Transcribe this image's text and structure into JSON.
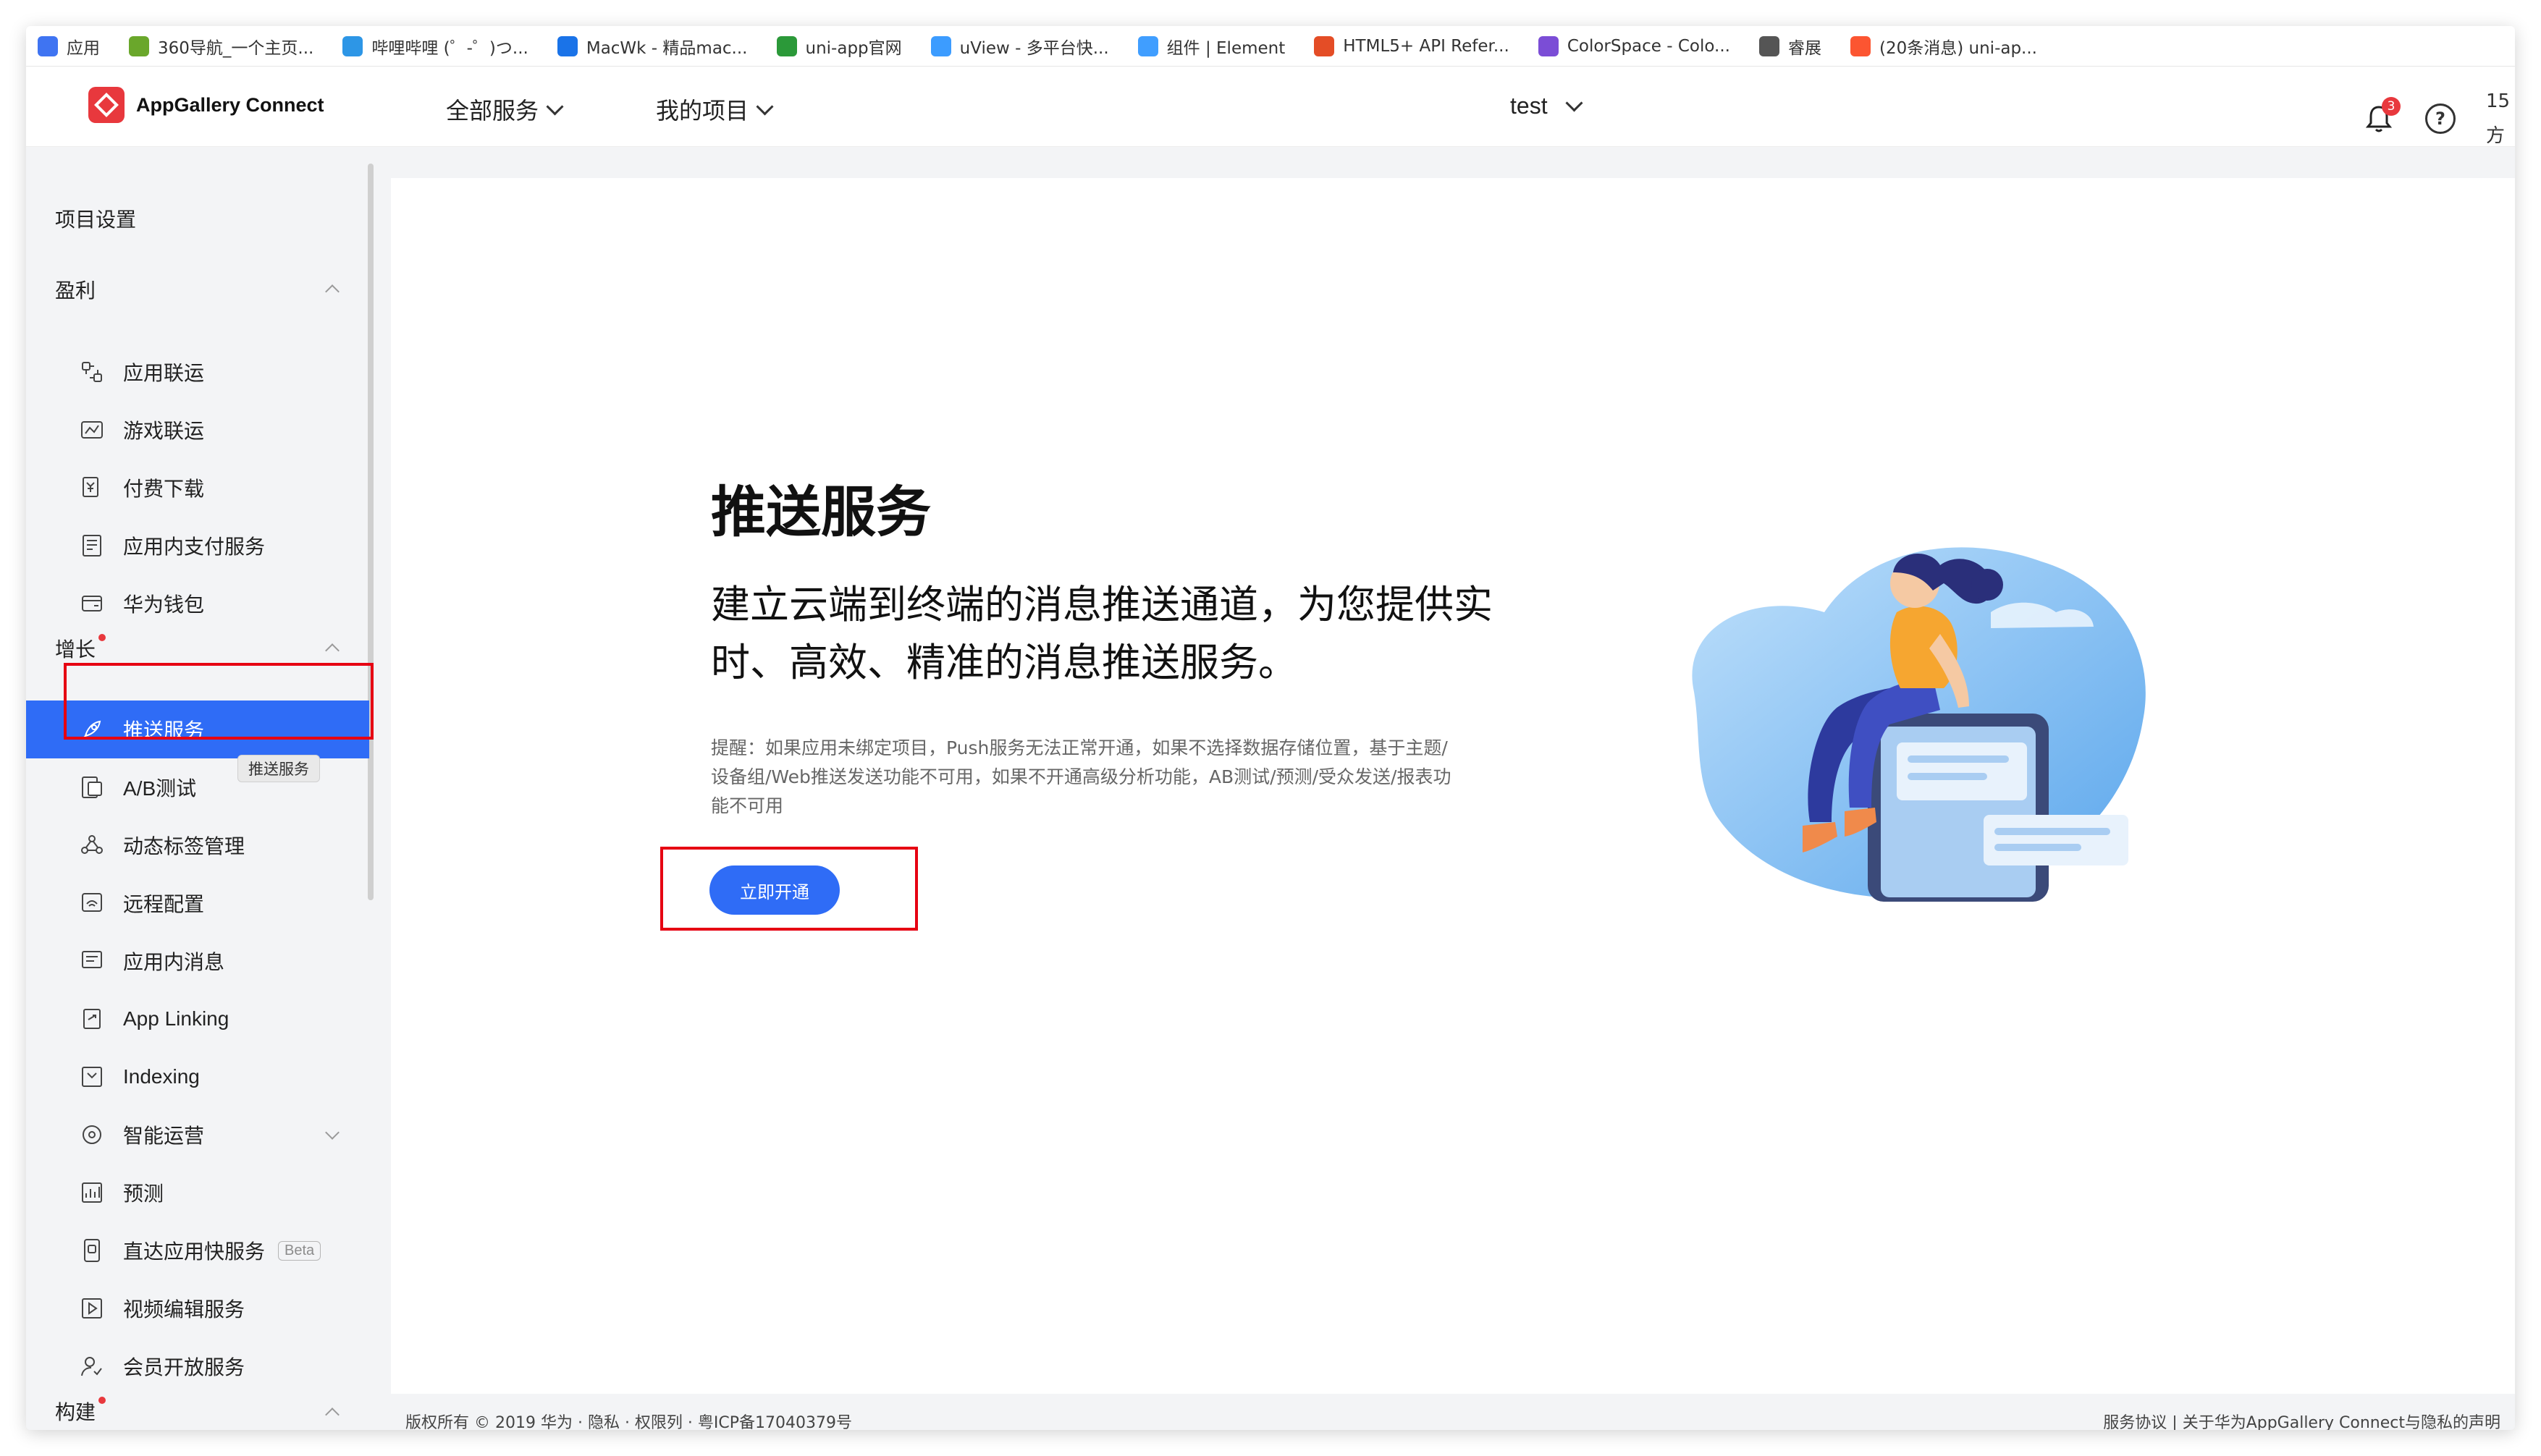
{
  "bookmarks": [
    {
      "label": "应用",
      "icon": "apps-grid-icon",
      "color": "#3f74f2"
    },
    {
      "label": "360导航_一个主页...",
      "icon": "360-icon",
      "color": "#6aa72b"
    },
    {
      "label": "哔哩哔哩 (゜-゜)つ...",
      "icon": "bilibili-icon",
      "color": "#2d96e6"
    },
    {
      "label": "MacWk - 精品mac...",
      "icon": "macwk-icon",
      "color": "#1a73e8"
    },
    {
      "label": "uni-app官网",
      "icon": "uniapp-icon",
      "color": "#2b9939"
    },
    {
      "label": "uView - 多平台快...",
      "icon": "uview-icon",
      "color": "#3c9cff"
    },
    {
      "label": "组件 | Element",
      "icon": "element-icon",
      "color": "#409eff"
    },
    {
      "label": "HTML5+ API Refer...",
      "icon": "html5-icon",
      "color": "#e44d26"
    },
    {
      "label": "ColorSpace - Colo...",
      "icon": "colorspace-icon",
      "color": "#7b4dd6"
    },
    {
      "label": "睿展",
      "icon": "folder-icon",
      "color": "#555555"
    },
    {
      "label": "(20条消息) uni-ap...",
      "icon": "csdn-icon",
      "color": "#fc5531"
    }
  ],
  "header": {
    "brand": "AppGallery Connect",
    "nav": {
      "all_services": "全部服务",
      "my_projects": "我的项目"
    },
    "project": "test",
    "notification_count": "3",
    "help": "?",
    "edge_line1": "15",
    "edge_line2": "方"
  },
  "sidebar": {
    "project_settings": "项目设置",
    "group_monetize": "盈利",
    "monetize_items": [
      "应用联运",
      "游戏联运",
      "付费下载",
      "应用内支付服务",
      "华为钱包"
    ],
    "group_grow": "增长",
    "grow_items": [
      "推送服务",
      "A/B测试",
      "动态标签管理",
      "远程配置",
      "应用内消息",
      "App Linking",
      "Indexing",
      "智能运营",
      "预测",
      "直达应用快服务",
      "视频编辑服务",
      "会员开放服务"
    ],
    "beta_label": "Beta",
    "tooltip": "推送服务",
    "group_build": "构建"
  },
  "main": {
    "title": "推送服务",
    "subtitle": "建立云端到终端的消息推送通道，为您提供实时、高效、精准的消息推送服务。",
    "note": "提醒：如果应用未绑定项目，Push服务无法正常开通，如果不选择数据存储位置，基于主题/设备组/Web推送发送功能不可用，如果不开通高级分析功能，AB测试/预测/受众发送/报表功能不可用",
    "enable_button": "立即开通"
  },
  "footer": {
    "left": "版权所有 © 2019 华为 · 隐私 · 权限列 · 粤ICP备17040379号",
    "right": "服务协议 | 关于华为AppGallery Connect与隐私的声明"
  },
  "colors": {
    "accent": "#2f6cf6",
    "highlight_box": "#e60012",
    "badge": "#e8383d"
  }
}
